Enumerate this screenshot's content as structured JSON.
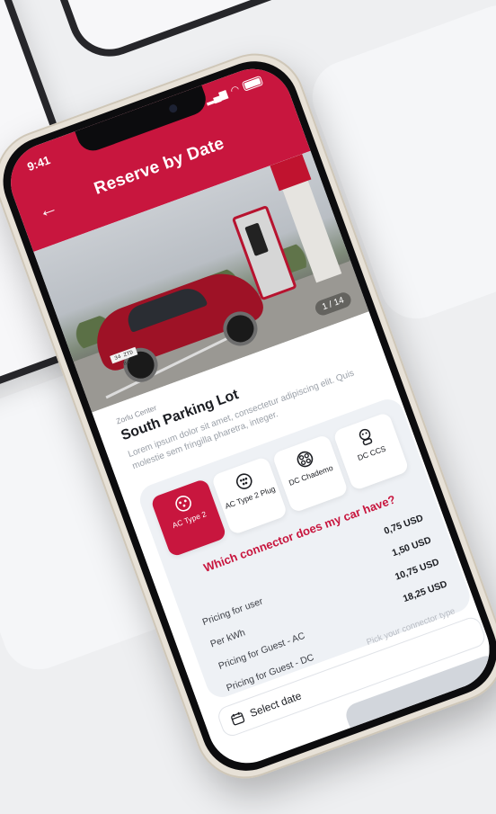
{
  "status": {
    "time": "9:41"
  },
  "header": {
    "title": "Reserve by Date",
    "back_icon": "back-arrow-icon"
  },
  "photo": {
    "counter": "1 / 14",
    "plate": "34 ZTD 84"
  },
  "location": {
    "subtitle": "Zorlu Center",
    "name": "South Parking Lot",
    "description": "Lorem ipsum dolor sit amet, consectetur adipiscing elit. Quis molestie sem fringilla pharetra, integer."
  },
  "connectors": [
    {
      "label": "AC Type 2",
      "icon": "ac-type2-icon",
      "selected": true
    },
    {
      "label": "AC Type 2 Plug",
      "icon": "ac-type2-plug-icon",
      "selected": false
    },
    {
      "label": "DC Chademo",
      "icon": "dc-chademo-icon",
      "selected": false
    },
    {
      "label": "DC CCS",
      "icon": "dc-ccs-icon",
      "selected": false
    }
  ],
  "question": "Which connector does my car have?",
  "pricing": [
    {
      "label": "",
      "value": "0,75 USD"
    },
    {
      "label": "Pricing for user",
      "value": "1,50 USD"
    },
    {
      "label": "Per kWh",
      "value": "10,75 USD"
    },
    {
      "label": "Pricing for Guest - AC",
      "value": "18,25 USD"
    },
    {
      "label": "Pricing for Guest - DC",
      "value": ""
    }
  ],
  "hint": "Pick your connector type",
  "date": {
    "label": "Select date"
  },
  "colors": {
    "accent": "#c8163e",
    "panel": "#eef1f5"
  }
}
